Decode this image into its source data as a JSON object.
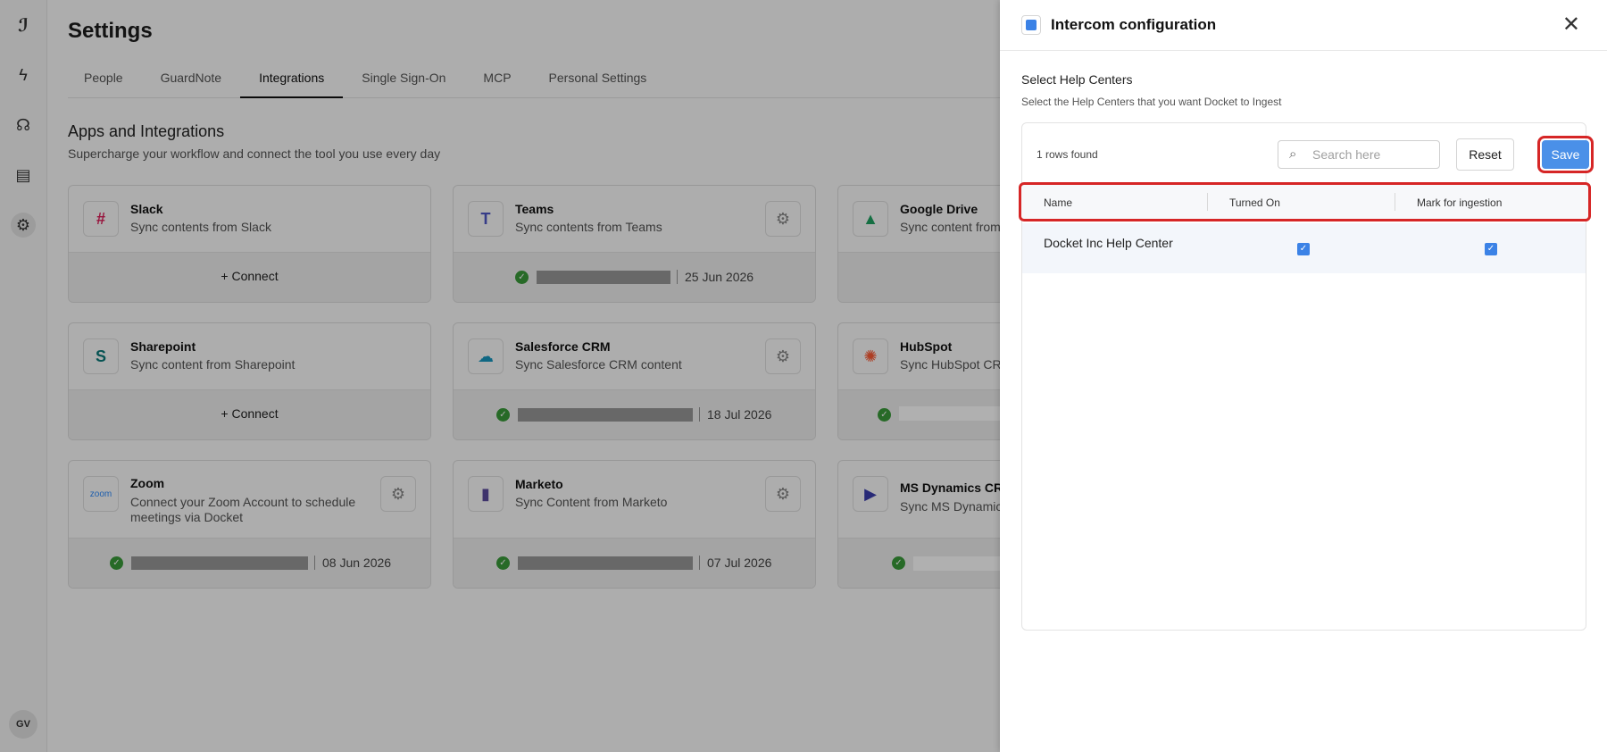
{
  "sidebar": {
    "avatar_initials": "GV",
    "icons": [
      "docket-logo-icon",
      "lightning-icon",
      "brain-icon",
      "document-icon",
      "gear-icon"
    ]
  },
  "page": {
    "title": "Settings",
    "tabs": [
      {
        "label": "People",
        "active": false
      },
      {
        "label": "GuardNote",
        "active": false
      },
      {
        "label": "Integrations",
        "active": true
      },
      {
        "label": "Single Sign-On",
        "active": false
      },
      {
        "label": "MCP",
        "active": false
      },
      {
        "label": "Personal Settings",
        "active": false
      }
    ],
    "section_title": "Apps and Integrations",
    "section_subtitle": "Supercharge your workflow and connect the tool you use every day"
  },
  "integrations": [
    {
      "name": "Slack",
      "desc": "Sync contents from Slack",
      "action": "Connect"
    },
    {
      "name": "Teams",
      "desc": "Sync contents from Teams",
      "date": "25 Jun 2026"
    },
    {
      "name": "Google Drive",
      "desc": "Sync content from"
    },
    {
      "name": "Sharepoint",
      "desc": "Sync content from Sharepoint",
      "action": "Connect"
    },
    {
      "name": "Salesforce CRM",
      "desc": "Sync Salesforce CRM content",
      "date": "18 Jul 2026"
    },
    {
      "name": "HubSpot",
      "desc": "Sync HubSpot CR"
    },
    {
      "name": "Zoom",
      "desc": "Connect your Zoom Account to schedule meetings via Docket",
      "logo_text": "zoom",
      "date": "08 Jun 2026"
    },
    {
      "name": "Marketo",
      "desc": "Sync Content from Marketo",
      "date": "07 Jul 2026"
    },
    {
      "name": "MS Dynamics CR",
      "desc": "Sync MS Dynamic"
    }
  ],
  "drawer": {
    "title": "Intercom configuration",
    "section_title": "Select Help Centers",
    "section_subtitle": "Select the Help Centers that you want Docket to Ingest",
    "rows_found": "1 rows found",
    "search_placeholder": "Search here",
    "reset_label": "Reset",
    "save_label": "Save",
    "columns": [
      "Name",
      "Turned On",
      "Mark for ingestion"
    ],
    "rows": [
      {
        "name": "Docket Inc Help Center",
        "turned_on": true,
        "ingest": true
      }
    ],
    "accent_color": "#4a90e8",
    "highlight_color": "#d62626"
  }
}
